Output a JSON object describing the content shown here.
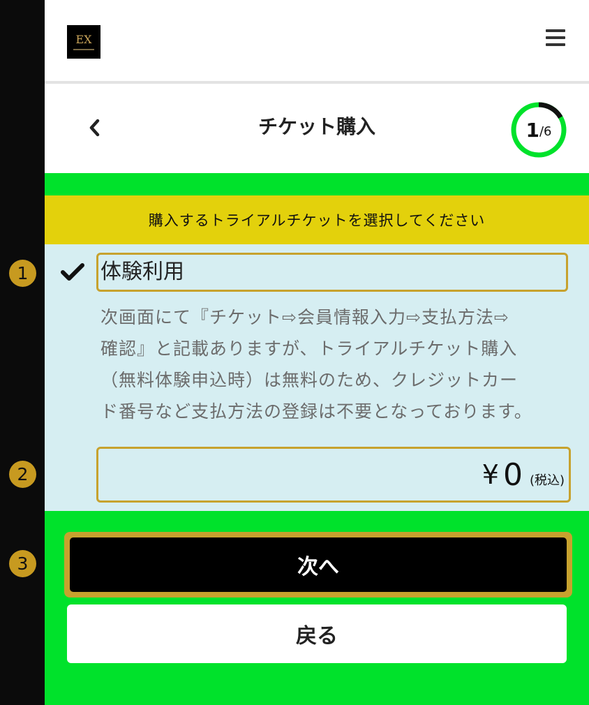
{
  "header": {
    "logo_text": "EX",
    "page_title": "チケット購入",
    "progress": {
      "current": "1",
      "total": "/6",
      "fraction": 0.1667
    }
  },
  "notice": {
    "text": "購入するトライアルチケットを選択してください"
  },
  "option": {
    "label": "体験利用",
    "selected": true,
    "description_lines": [
      "次画面にて『チケット⇨会員情報入力⇨支払方法⇨",
      "確認』と記載ありますが、トライアルチケット購入",
      "（無料体験申込時）は無料のため、クレジットカー",
      "ド番号など支払方法の登録は不要となっております。"
    ]
  },
  "price": {
    "currency": "¥",
    "value": "0",
    "tax_note": "(税込)"
  },
  "actions": {
    "next_label": "次へ",
    "back_label": "戻る"
  },
  "markers": [
    "1",
    "2",
    "3"
  ],
  "colors": {
    "accent_green": "#00e22b",
    "notice_yellow": "#e3d10c",
    "panel_blue": "#d6eef2",
    "highlight_gold": "#c7a22e"
  }
}
